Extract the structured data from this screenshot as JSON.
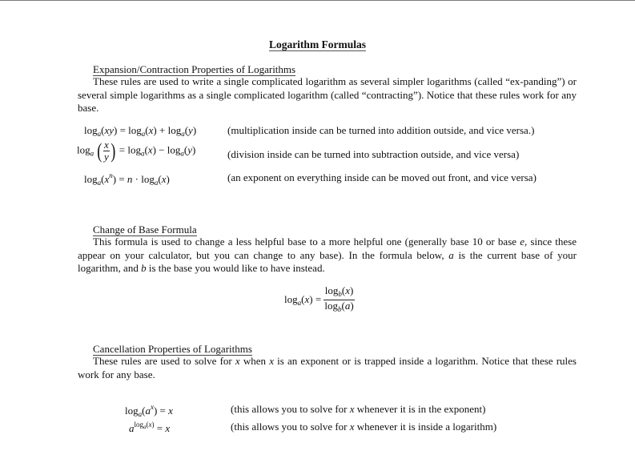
{
  "page_title": "Logarithm Formulas",
  "sections": [
    {
      "heading": "Expansion/Contraction Properties of Logarithms",
      "paragraph": "These rules are used to write a single complicated logarithm as several simpler logarithms (called “ex-panding”) or several simple logarithms as a single complicated logarithm (called “contracting”). Notice that these rules work for any base.",
      "formulas": [
        {
          "equation": "log_a(xy) = log_a(x) + log_a(y)",
          "note": "(multiplication inside can be turned into addition outside, and vice versa.)"
        },
        {
          "equation": "log_a(x/y) = log_a(x) − log_a(y)",
          "note": "(division inside can be turned into subtraction outside, and vice versa)"
        },
        {
          "equation": "log_a(x^n) = n · log_a(x)",
          "note": "(an exponent on everything inside can be moved out front, and vice versa)"
        }
      ]
    },
    {
      "heading": "Change of Base Formula",
      "paragraph_parts": {
        "p1": "This formula is used to change a less helpful base to a more helpful one (generally base 10 or base ",
        "e": "e",
        "p2": ", since these appear on your calculator, but you can change to any base). In the formula below, ",
        "a": "a",
        "p3": " is the current base of your logarithm, and ",
        "b": "b",
        "p4": " is the base you would like to have instead."
      },
      "formula": {
        "equation": "log_a(x) = log_b(x) / log_b(a)"
      }
    },
    {
      "heading": "Cancellation Properties of Logarithms",
      "paragraph_parts": {
        "p1": "These rules are used to solve for ",
        "x1": "x",
        "p2": " when ",
        "x2": "x",
        "p3": " is an exponent or is trapped inside a logarithm. Notice that these rules work for any base."
      },
      "formulas": [
        {
          "equation": "log_a(a^x) = x",
          "note_parts": {
            "p1": "(this allows you to solve for ",
            "x": "x",
            "p2": " whenever it is in the exponent)"
          }
        },
        {
          "equation": "a^(log_a(x)) = x",
          "note_parts": {
            "p1": "(this allows you to solve for ",
            "x": "x",
            "p2": " whenever it is inside a logarithm)"
          }
        }
      ]
    }
  ],
  "math_tokens": {
    "log": "log",
    "a": "a",
    "b": "b",
    "x": "x",
    "y": "y",
    "n": "n",
    "xy": "xy",
    "eq": "=",
    "plus": "+",
    "minus": "−",
    "cdot": "·",
    "lp": "(",
    "rp": ")"
  }
}
